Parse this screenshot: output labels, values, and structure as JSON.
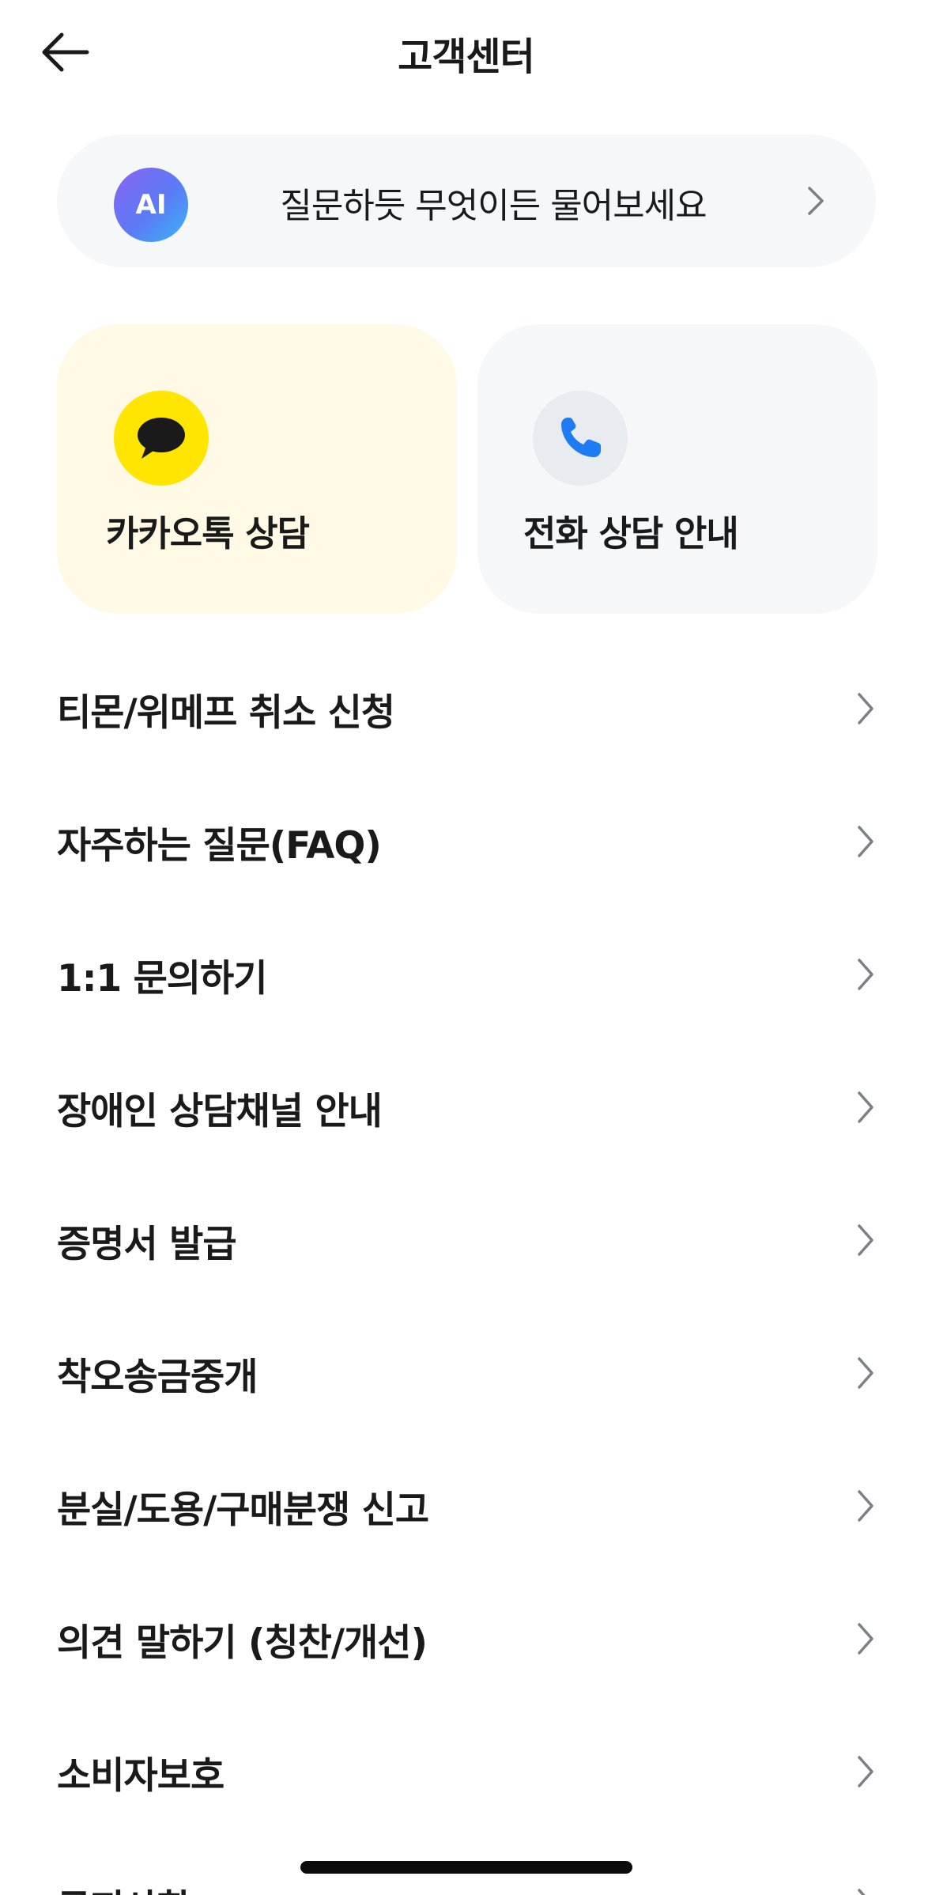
{
  "header": {
    "title": "고객센터",
    "back_icon": "arrow-left-icon"
  },
  "ai_search": {
    "badge": "AI",
    "text": "질문하듯 무엇이든 물어보세요",
    "colors": {
      "from": "#8a63f2",
      "to": "#39b6f7"
    }
  },
  "cards": {
    "kakao": {
      "label": "카카오톡 상담",
      "icon": "chat-bubble-icon",
      "bg": "#fff9e6",
      "icon_bg": "#ffe500"
    },
    "phone": {
      "label": "전화 상담 안내",
      "icon": "phone-icon",
      "bg": "#f5f7f9",
      "icon_color": "#1d7cf2"
    }
  },
  "menu": {
    "items": [
      {
        "label": "티몬/위메프 취소 신청"
      },
      {
        "label": "자주하는 질문(FAQ)"
      },
      {
        "label": "1:1 문의하기"
      },
      {
        "label": "장애인 상담채널 안내"
      },
      {
        "label": "증명서 발급"
      },
      {
        "label": "착오송금중개"
      },
      {
        "label": "분실/도용/구매분쟁 신고"
      },
      {
        "label": "의견 말하기 (칭찬/개선)"
      },
      {
        "label": "소비자보호"
      },
      {
        "label": "공지사항"
      }
    ]
  }
}
